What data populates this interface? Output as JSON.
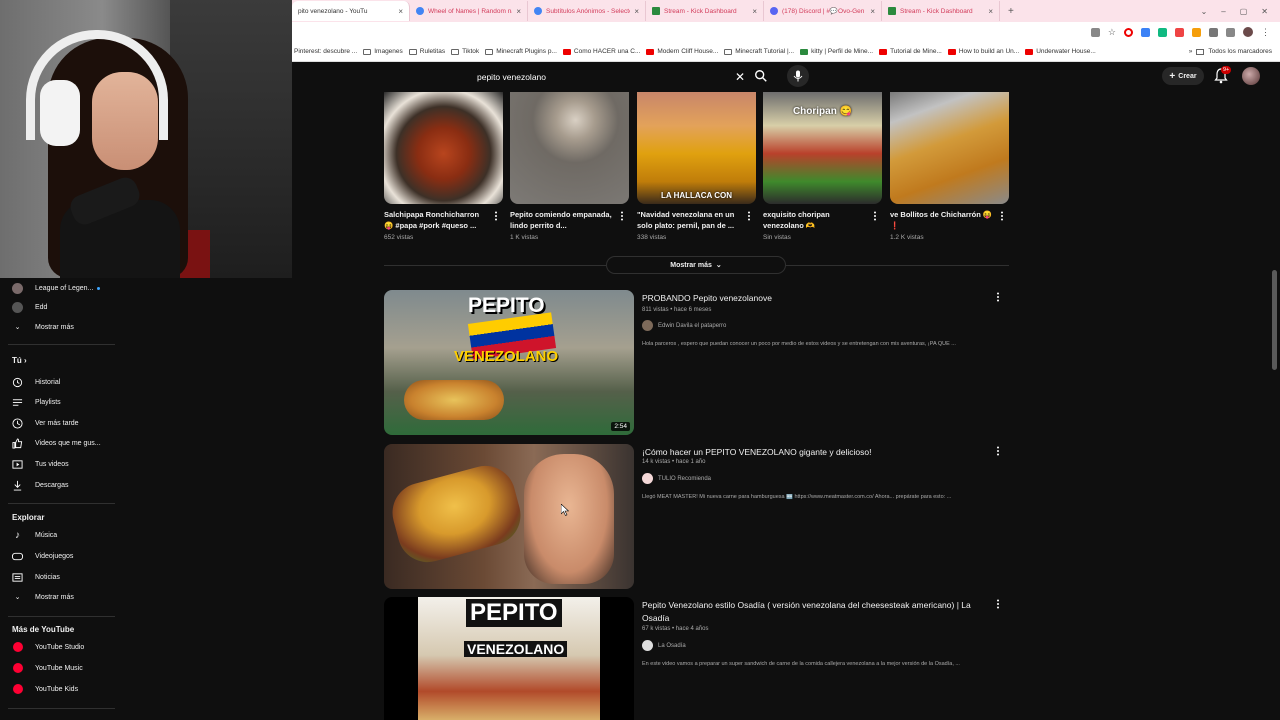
{
  "browser": {
    "tabs": [
      {
        "title": "pito venezolano - YouTu",
        "color": "#ff0000"
      },
      {
        "title": "Wheel of Names | Random nam",
        "color": "#4285f4"
      },
      {
        "title": "Subtítulos Anónimos - Selector Perso",
        "color": "#4285f4"
      },
      {
        "title": "Stream - Kick Dashboard",
        "color": "#2b8a3e"
      },
      {
        "title": "(178) Discord | #💬Ovo-Gen",
        "color": "#5865f2"
      },
      {
        "title": "Stream - Kick Dashboard",
        "color": "#2b8a3e"
      }
    ],
    "bookmarks": [
      {
        "label": "Pinterest: descubre ...",
        "kind": "folder"
      },
      {
        "label": "Imagenes",
        "kind": "folder"
      },
      {
        "label": "Ruletitas",
        "kind": "folder"
      },
      {
        "label": "Tiktok",
        "kind": "folder"
      },
      {
        "label": "Minecraft Plugins p...",
        "kind": "folder"
      },
      {
        "label": "Como HACER una C...",
        "kind": "red"
      },
      {
        "label": "Modern Cliff House...",
        "kind": "red"
      },
      {
        "label": "Minecraft Tutorial |...",
        "kind": "folder"
      },
      {
        "label": "kitty | Perfil de Mine...",
        "kind": "folder"
      },
      {
        "label": "Tutorial de Mine...",
        "kind": "red"
      },
      {
        "label": "How to build an Un...",
        "kind": "red"
      },
      {
        "label": "Underwater House...",
        "kind": "red"
      }
    ],
    "bookmarks_all": "Todos los marcadores"
  },
  "youtube": {
    "search_query": "pepito venezolano",
    "create_label": "Crear",
    "notif_count": "9+"
  },
  "sidebar": {
    "top_items": [
      {
        "label": "League of Legen...",
        "icon": "channel-avatar-icon"
      },
      {
        "label": "Edd",
        "icon": "channel-avatar-icon"
      },
      {
        "label": "Mostrar más",
        "icon": "chevron-down-icon"
      }
    ],
    "you_header": "Tú",
    "you_items": [
      {
        "label": "Historial",
        "icon": "history-icon"
      },
      {
        "label": "Playlists",
        "icon": "playlist-icon"
      },
      {
        "label": "Ver más tarde",
        "icon": "clock-icon"
      },
      {
        "label": "Videos que me gus...",
        "icon": "thumbs-up-icon"
      },
      {
        "label": "Tus videos",
        "icon": "video-icon"
      },
      {
        "label": "Descargas",
        "icon": "download-icon"
      }
    ],
    "explore_header": "Explorar",
    "explore_items": [
      {
        "label": "Música",
        "icon": "music-icon"
      },
      {
        "label": "Videojuegos",
        "icon": "gamepad-icon"
      },
      {
        "label": "Noticias",
        "icon": "news-icon"
      },
      {
        "label": "Mostrar más",
        "icon": "chevron-down-icon"
      }
    ],
    "more_header": "Más de YouTube",
    "more_items": [
      {
        "label": "YouTube Studio",
        "icon": "youtube-studio-icon"
      },
      {
        "label": "YouTube Music",
        "icon": "youtube-music-icon"
      },
      {
        "label": "YouTube Kids",
        "icon": "youtube-kids-icon"
      }
    ]
  },
  "shorts": [
    {
      "title": "Salchipapa Ronchicharron 😝 #papa #pork #queso ...",
      "views": "652 vistas"
    },
    {
      "title": "Pepito comiendo empanada, lindo perrito d...",
      "views": "1 K vistas"
    },
    {
      "title": "\"Navidad venezolana en un solo plato: pernil, pan de ...",
      "views": "338 vistas",
      "overlay": "LA HALLACA CON"
    },
    {
      "title": "exquisito choripan venezolano 🫶",
      "views": "Sin vistas",
      "overlay": "Choripan 😋"
    },
    {
      "title": "ve Bollitos de Chicharrón 😝❗",
      "views": "1.2 K vistas"
    }
  ],
  "show_more": "Mostrar más",
  "videos": [
    {
      "title": "PROBANDO Pepito venezolanove",
      "meta": "811 vistas • hace 6 meses",
      "channel": "Edwin Davila el pataperro",
      "desc": "Hola parceros , espero que puedan conocer un poco por medio de estos videos y se entretengan con mis aventuras, ¡PA QUE ...",
      "duration": "2:54",
      "thumb_text_1": "PEPITO",
      "thumb_text_2": "VENEZOLANO"
    },
    {
      "title": "¡Cómo hacer un PEPITO VENEZOLANO gigante y delicioso!",
      "meta": "14 k vistas • hace 1 año",
      "channel": "TULIO Recomienda",
      "desc": "Llegó MEAT MASTER! Mi nueva carne para hamburguesa 🆕 https://www.meatmaster.com.co/ Ahora... prepárate para esto: ...",
      "duration": ""
    },
    {
      "title": "Pepito Venezolano estilo Osadía ( versión venezolana del cheesesteak americano) | La Osadía",
      "meta": "67 k vistas • hace 4 años",
      "channel": "La Osadía",
      "desc": "En este video vamos a preparar un super sandwich de carne de la comida callejera venezolana a la mejor versión de la Osadía, ...",
      "duration": "",
      "thumb_text_1": "PEPITO",
      "thumb_text_2": "VENEZOLANO"
    }
  ]
}
